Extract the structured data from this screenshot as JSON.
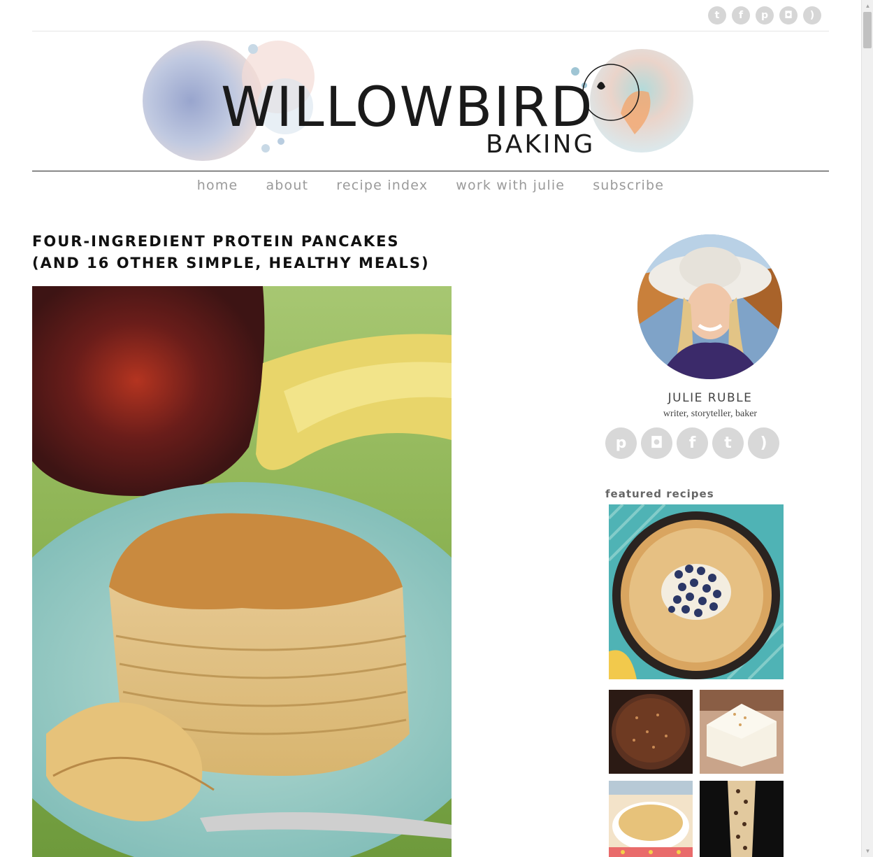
{
  "top_social": [
    {
      "name": "twitter-icon",
      "glyph": "t"
    },
    {
      "name": "facebook-icon",
      "glyph": "f"
    },
    {
      "name": "pinterest-icon",
      "glyph": "p"
    },
    {
      "name": "instagram-icon",
      "glyph": "◘"
    },
    {
      "name": "rss-icon",
      "glyph": ")"
    }
  ],
  "logo": {
    "word1": "WILLOWBIRD",
    "word2": "BAKING"
  },
  "nav": {
    "items": [
      "home",
      "about",
      "recipe index",
      "work with julie",
      "subscribe"
    ]
  },
  "post": {
    "title": "FOUR-INGREDIENT PROTEIN PANCAKES (AND 16 OTHER SIMPLE, HEALTHY MEALS)"
  },
  "author": {
    "name": "JULIE RUBLE",
    "tagline": "writer, storyteller, baker"
  },
  "side_social": [
    {
      "name": "pinterest-icon",
      "glyph": "p"
    },
    {
      "name": "instagram-icon",
      "glyph": "◘"
    },
    {
      "name": "facebook-icon",
      "glyph": "f"
    },
    {
      "name": "twitter-icon",
      "glyph": "t"
    },
    {
      "name": "rss-icon",
      "glyph": ")"
    }
  ],
  "featured": {
    "heading": "featured recipes"
  },
  "colors": {
    "accent_text": "#9a9a9a",
    "icon_gray": "#d6d6d6",
    "title_text": "#111111"
  }
}
